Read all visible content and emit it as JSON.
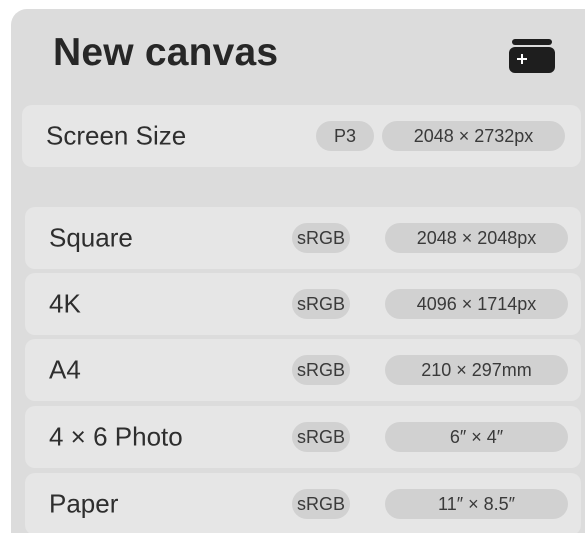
{
  "title": "New canvas",
  "new_button_icon": "add-canvas-icon",
  "screen_size": {
    "label": "Screen Size",
    "color_profile": "P3",
    "dimensions": "2048 × 2732px"
  },
  "presets": [
    {
      "label": "Square",
      "color_profile": "sRGB",
      "dimensions": "2048 × 2048px"
    },
    {
      "label": "4K",
      "color_profile": "sRGB",
      "dimensions": "4096 × 1714px"
    },
    {
      "label": "A4",
      "color_profile": "sRGB",
      "dimensions": "210 × 297mm"
    },
    {
      "label": "4 × 6 Photo",
      "color_profile": "sRGB",
      "dimensions": "6″ × 4″"
    },
    {
      "label": "Paper",
      "color_profile": "sRGB",
      "dimensions": "11″ × 8.5″"
    }
  ]
}
